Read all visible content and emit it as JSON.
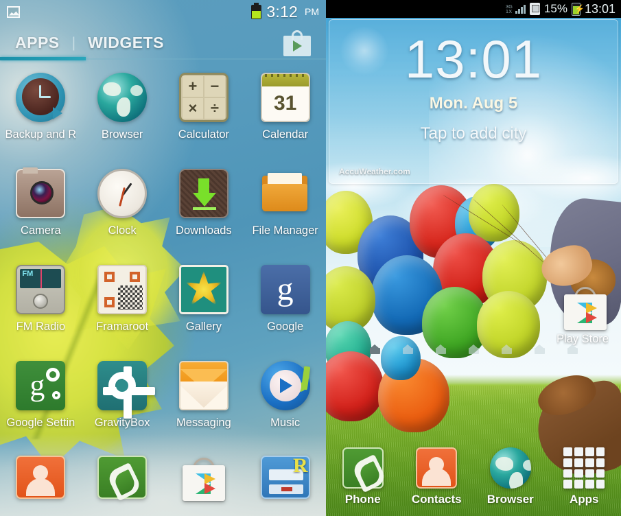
{
  "left_panel": {
    "status_bar": {
      "notification_icon": "image-screenshot-icon",
      "time": "3:12",
      "ampm": "PM",
      "battery_icon": "battery-icon"
    },
    "tabs": {
      "apps_label": "APPS",
      "divider": "|",
      "widgets_label": "WIDGETS",
      "active": "APPS",
      "accent_color": "#1f9ab4"
    },
    "shop_button": "play-shop-icon",
    "apps": [
      [
        {
          "label": "Backup and R",
          "icon": "backup-and-restore-icon"
        },
        {
          "label": "Browser",
          "icon": "browser-globe-icon"
        },
        {
          "label": "Calculator",
          "icon": "calculator-icon"
        },
        {
          "label": "Calendar",
          "icon": "calendar-icon"
        }
      ],
      [
        {
          "label": "Camera",
          "icon": "camera-icon"
        },
        {
          "label": "Clock",
          "icon": "clock-icon"
        },
        {
          "label": "Downloads",
          "icon": "downloads-icon"
        },
        {
          "label": "File Manager",
          "icon": "file-manager-folder-icon"
        }
      ],
      [
        {
          "label": "FM Radio",
          "icon": "fm-radio-icon"
        },
        {
          "label": "Framaroot",
          "icon": "framaroot-qr-icon"
        },
        {
          "label": "Gallery",
          "icon": "gallery-flower-icon"
        },
        {
          "label": "Google",
          "icon": "google-g-icon"
        }
      ],
      [
        {
          "label": "Google Settin",
          "icon": "google-settings-icon"
        },
        {
          "label": "GravityBox",
          "icon": "gravitybox-gear-icon"
        },
        {
          "label": "Messaging",
          "icon": "messaging-envelope-icon"
        },
        {
          "label": "Music",
          "icon": "music-icon"
        }
      ],
      [
        {
          "label": "",
          "icon": "contacts-icon"
        },
        {
          "label": "",
          "icon": "phone-icon"
        },
        {
          "label": "",
          "icon": "play-store-icon"
        },
        {
          "label": "",
          "icon": "root-explorer-icon"
        }
      ]
    ],
    "calculator_keys": [
      "+",
      "−",
      "×",
      "÷"
    ],
    "calendar_day": "31"
  },
  "right_panel": {
    "status_bar": {
      "network_3g": "3G",
      "network_1x": "1X",
      "signal_icon": "signal-bars-icon",
      "sim_icon": "sim-card-icon",
      "battery_percent": "15%",
      "charging_icon": "charging-bolt-icon",
      "time": "13:01"
    },
    "weather_widget": {
      "time": "13:01",
      "date": "Mon. Aug 5",
      "city_prompt": "Tap to add city",
      "provider": "AccuWeather.com"
    },
    "home_icon": {
      "label": "Play Store",
      "icon": "play-store-icon"
    },
    "page_indicators": {
      "count": 7,
      "active_index": 0,
      "icon": "home-page-indicator-icon"
    },
    "dock": [
      {
        "label": "Phone",
        "icon": "phone-icon"
      },
      {
        "label": "Contacts",
        "icon": "contacts-icon"
      },
      {
        "label": "Browser",
        "icon": "browser-globe-icon"
      },
      {
        "label": "Apps",
        "icon": "apps-grid-icon"
      }
    ]
  }
}
